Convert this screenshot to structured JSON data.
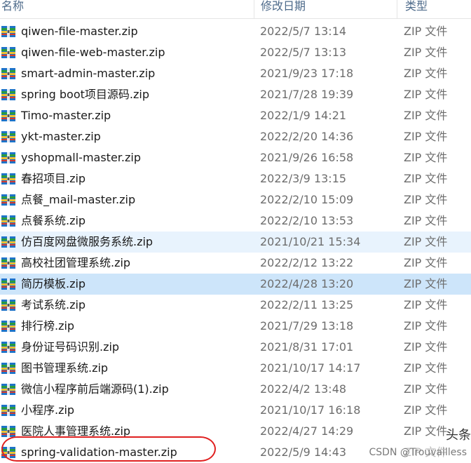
{
  "header": {
    "name": "名称",
    "date": "修改日期",
    "type": "类型"
  },
  "colors": {
    "icon_blue": "#1e73c8",
    "icon_green": "#2a9d3c",
    "icon_yellow": "#f2c12e",
    "icon_red": "#d93a2b",
    "annotation": "#e02020"
  },
  "files": [
    {
      "name": "qiwen-file-master.zip",
      "date": "2022/5/7 13:14",
      "type": "ZIP 文件"
    },
    {
      "name": "qiwen-file-web-master.zip",
      "date": "2022/5/7 13:13",
      "type": "ZIP 文件"
    },
    {
      "name": "smart-admin-master.zip",
      "date": "2021/9/23 17:18",
      "type": "ZIP 文件"
    },
    {
      "name": "spring boot项目源码.zip",
      "date": "2021/7/28 19:39",
      "type": "ZIP 文件"
    },
    {
      "name": "Timo-master.zip",
      "date": "2022/1/9 14:21",
      "type": "ZIP 文件"
    },
    {
      "name": "ykt-master.zip",
      "date": "2022/2/20 14:36",
      "type": "ZIP 文件"
    },
    {
      "name": "yshopmall-master.zip",
      "date": "2021/9/26 16:58",
      "type": "ZIP 文件"
    },
    {
      "name": "春招项目.zip",
      "date": "2022/3/9 13:15",
      "type": "ZIP 文件"
    },
    {
      "name": "点餐_mail-master.zip",
      "date": "2022/2/10 15:09",
      "type": "ZIP 文件"
    },
    {
      "name": "点餐系统.zip",
      "date": "2022/2/10 13:53",
      "type": "ZIP 文件"
    },
    {
      "name": "仿百度网盘微服务系统.zip",
      "date": "2021/10/21 15:34",
      "type": "ZIP 文件"
    },
    {
      "name": "高校社团管理系统.zip",
      "date": "2022/2/12 13:22",
      "type": "ZIP 文件"
    },
    {
      "name": "简历模板.zip",
      "date": "2022/4/28 13:20",
      "type": "ZIP 文件"
    },
    {
      "name": "考试系统.zip",
      "date": "2022/2/11 13:25",
      "type": "ZIP 文件"
    },
    {
      "name": "排行榜.zip",
      "date": "2021/7/29 13:18",
      "type": "ZIP 文件"
    },
    {
      "name": "身份证号码识别.zip",
      "date": "2021/8/31 17:01",
      "type": "ZIP 文件"
    },
    {
      "name": "图书管理系统.zip",
      "date": "2021/10/17 14:17",
      "type": "ZIP 文件"
    },
    {
      "name": "微信小程序前后端源码(1).zip",
      "date": "2022/4/2 13:48",
      "type": "ZIP 文件"
    },
    {
      "name": "小程序.zip",
      "date": "2021/10/17 16:18",
      "type": "ZIP 文件"
    },
    {
      "name": "医院人事管理系统.zip",
      "date": "2022/4/27 14:29",
      "type": "ZIP 文件"
    },
    {
      "name": "spring-validation-master.zip",
      "date": "2022/5/9 14:43",
      "type": "ZIP 文件"
    }
  ],
  "watermark": "CSDN @Trouvailless",
  "overlay_text": "头条"
}
